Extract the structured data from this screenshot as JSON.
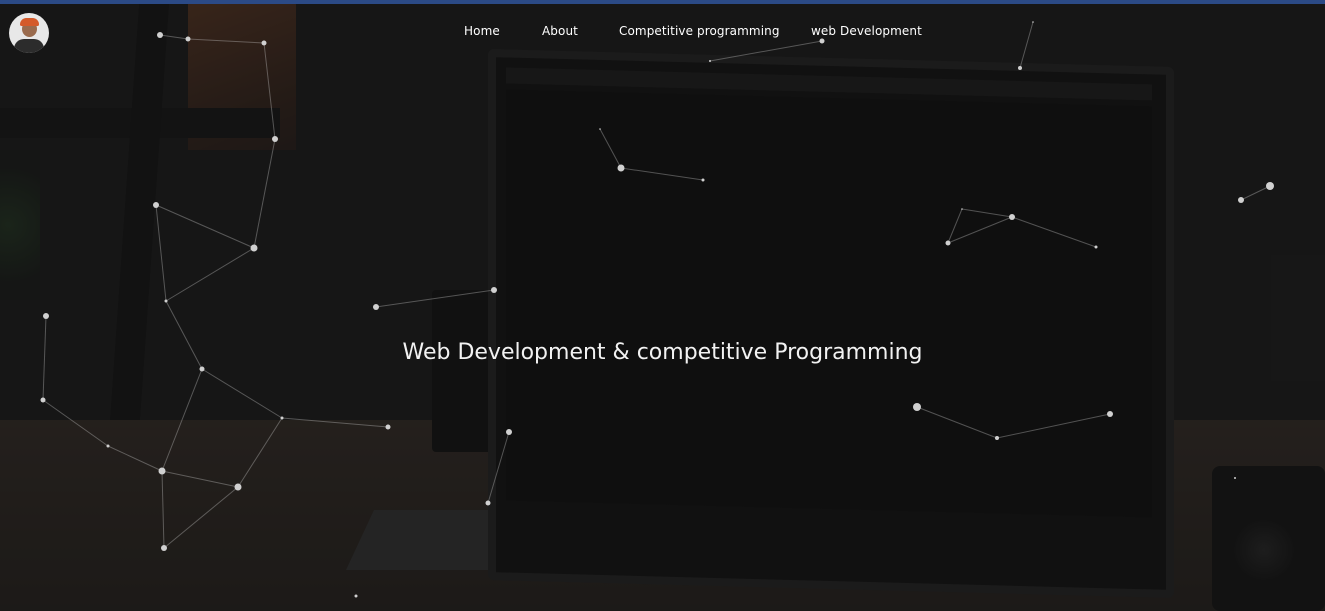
{
  "nav": {
    "items": [
      {
        "label": "Home"
      },
      {
        "label": "About"
      },
      {
        "label": "Competitive programming"
      },
      {
        "label": "web Development"
      }
    ]
  },
  "hero": {
    "title": "Web Development & competitive Programming"
  },
  "colors": {
    "top_accent": "#2b4a86",
    "nav_text": "#ffffff",
    "hero_text": "#f2f2f2",
    "particle": "#d0d0d0"
  },
  "icons": {
    "avatar": "profile-avatar"
  }
}
